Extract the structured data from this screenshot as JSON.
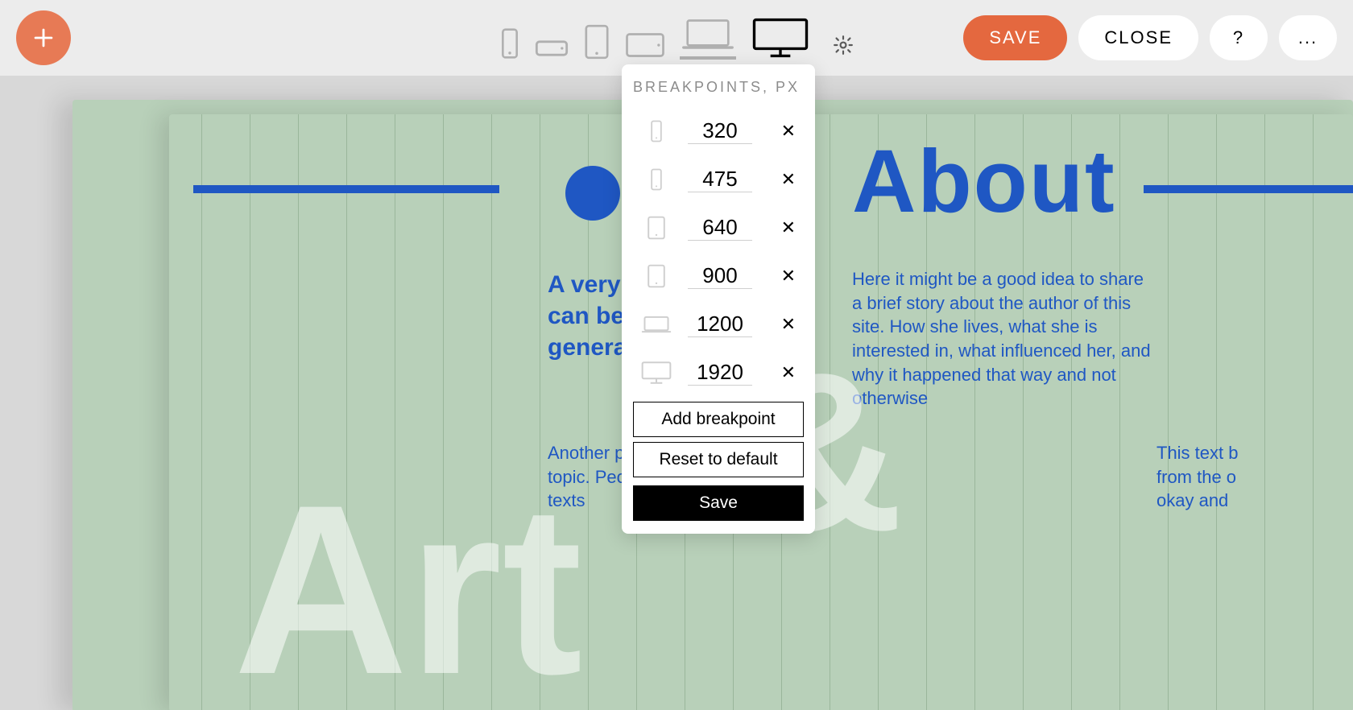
{
  "toolbar": {
    "save_label": "SAVE",
    "close_label": "CLOSE",
    "help_label": "?",
    "more_label": "..."
  },
  "popover": {
    "title": "BREAKPOINTS, PX",
    "breakpoints": [
      "320",
      "475",
      "640",
      "900",
      "1200",
      "1920"
    ],
    "add_label": "Add breakpoint",
    "reset_label": "Reset to default",
    "save_label": "Save"
  },
  "canvas": {
    "about_title": "About",
    "ampersand": "&",
    "art_word": "Art",
    "intro": "A very in\ncan be t\ngeneral",
    "small1": "Another par\ntopic. Peop\ntexts",
    "bio": "Here it might be a good idea to share a brief story about the author of this site. How she lives, what she is interested in, what influenced her, and why it happened that way and not otherwise",
    "small2": "This text b\nfrom the o\nokay and"
  }
}
